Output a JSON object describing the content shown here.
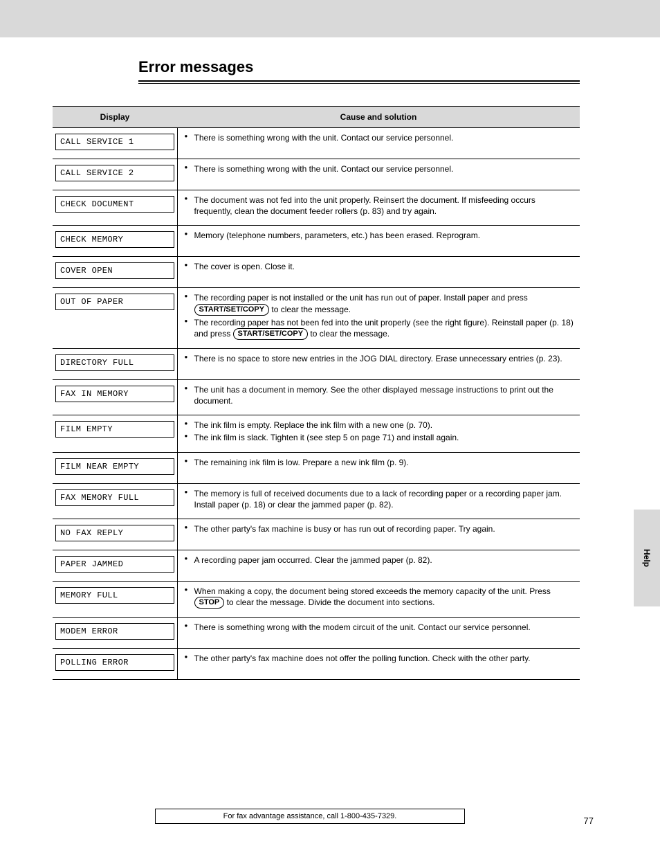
{
  "section_title": "Error messages",
  "side_tab": "Help",
  "tableHeaders": {
    "display": "Display",
    "cause": "Cause and solution"
  },
  "rows": [
    {
      "msg": "CALL SERVICE 1",
      "causes": [
        "There is something wrong with the unit. Contact our service personnel."
      ]
    },
    {
      "msg": "CALL SERVICE 2",
      "causes": [
        "There is something wrong with the unit. Contact our service personnel."
      ]
    },
    {
      "msg": "CHECK DOCUMENT",
      "causes": [
        "The document was not fed into the unit properly. Reinsert the document. If misfeeding occurs frequently, clean the document feeder rollers (p. 83) and try again."
      ]
    },
    {
      "msg": "CHECK MEMORY",
      "causes": [
        "Memory (telephone numbers, parameters, etc.) has been erased. Reprogram."
      ]
    },
    {
      "msg": "COVER OPEN",
      "causes": [
        "The cover is open. Close it."
      ]
    },
    {
      "msg": "DIRECTORY FULL",
      "causes": [
        "There is no space to store new entries in the JOG DIAL directory. Erase unnecessary entries (p. 23)."
      ]
    },
    {
      "msg": "FAX IN MEMORY",
      "causes": [
        "The unit has a document in memory. See the other displayed message instructions to print out the document."
      ]
    },
    {
      "msg": "FAX MEMORY FULL",
      "causes": [
        "The memory is full of received documents due to a lack of recording paper or a recording paper jam. Install paper (p. 18) or clear the jammed paper (p. 82)."
      ]
    },
    {
      "msg": "FILM EMPTY",
      "causes": [
        "The ink film is empty. Replace the ink film with a new one (p. 70).",
        "The ink film is slack. Tighten it (see step 5 on page 71) and install again."
      ]
    },
    {
      "msg": "FILM NEAR EMPTY",
      "causes": [
        "The remaining ink film is low. Prepare a new ink film (p. 9)."
      ]
    },
    {
      "msg": "MEMORY FULL",
      "causes": [
        "When making a copy, the document being stored exceeds the memory capacity of the unit. Press {STOP} to clear the message. Divide the document into sections."
      ]
    },
    {
      "msg": "MODEM ERROR",
      "causes": [
        "There is something wrong with the modem circuit of the unit. Contact our service personnel."
      ]
    },
    {
      "msg": "NO FAX REPLY",
      "causes": [
        "The other party's fax machine is busy or has run out of recording paper. Try again."
      ]
    },
    {
      "msg": "OUT OF PAPER",
      "causes": [
        "The recording paper is not installed or the unit has run out of paper. Install paper and press {START/SET/COPY} to clear the message.",
        "The recording paper has not been fed into the unit properly (see the right figure). Reinstall paper (p. 18) and press {START/SET/COPY} to clear the message."
      ]
    },
    {
      "msg": "PAPER JAMMED",
      "causes": [
        "A recording paper jam occurred. Clear the jammed paper (p. 82)."
      ]
    },
    {
      "msg": "POLLING ERROR",
      "causes": [
        "The other party's fax machine does not offer the polling function. Check with the other party."
      ]
    }
  ],
  "footer": "For fax advantage assistance, call 1-800-435-7329.",
  "page_number": "77"
}
